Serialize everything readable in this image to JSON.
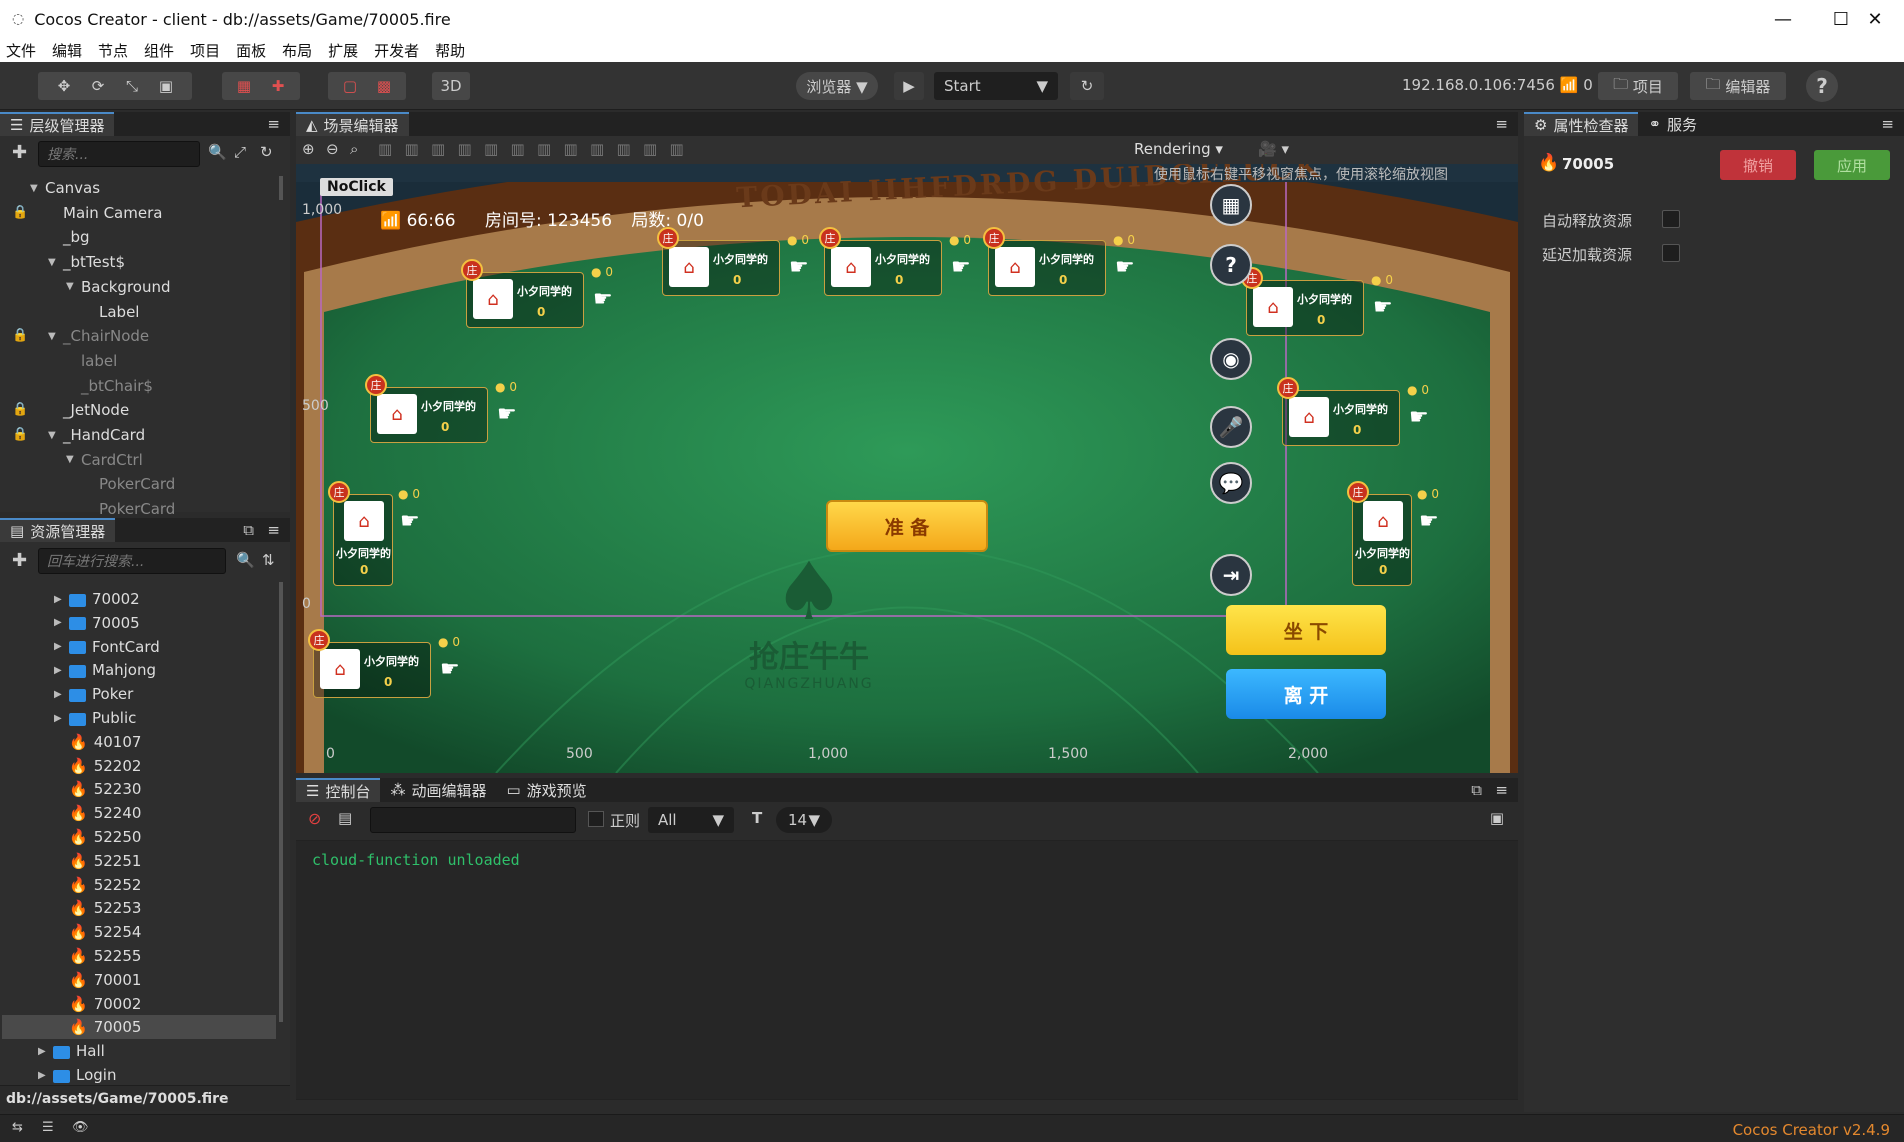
{
  "window": {
    "title": "Cocos Creator - client - db://assets/Game/70005.fire",
    "min": "—",
    "max": "☐",
    "close": "✕"
  },
  "menu": [
    "文件",
    "编辑",
    "节点",
    "组件",
    "项目",
    "面板",
    "布局",
    "扩展",
    "开发者",
    "帮助"
  ],
  "toolbar": {
    "browser_label": "浏览器 ▼",
    "play": "▶",
    "start_select": "Start",
    "three_d": "3D",
    "ip": "192.168.0.106:7456",
    "conn_count": "0",
    "project_btn": "项目",
    "editor_btn": "编辑器",
    "help": "?"
  },
  "hierarchy": {
    "tab": "层级管理器",
    "search_placeholder": "搜索...",
    "items": [
      {
        "label": "Canvas",
        "depth": 0,
        "open": true,
        "lock": false,
        "dim": false
      },
      {
        "label": "Main Camera",
        "depth": 1,
        "open": null,
        "lock": true,
        "dim": false
      },
      {
        "label": "_bg",
        "depth": 1,
        "open": null,
        "lock": false,
        "dim": false
      },
      {
        "label": "_btTest$",
        "depth": 1,
        "open": true,
        "lock": false,
        "dim": false
      },
      {
        "label": "Background",
        "depth": 2,
        "open": true,
        "lock": false,
        "dim": false
      },
      {
        "label": "Label",
        "depth": 3,
        "open": null,
        "lock": false,
        "dim": false
      },
      {
        "label": "_ChairNode",
        "depth": 1,
        "open": true,
        "lock": true,
        "dim": true
      },
      {
        "label": "label",
        "depth": 2,
        "open": null,
        "lock": false,
        "dim": true
      },
      {
        "label": "_btChair$",
        "depth": 2,
        "open": null,
        "lock": false,
        "dim": true
      },
      {
        "label": "_JetNode",
        "depth": 1,
        "open": null,
        "lock": true,
        "dim": false
      },
      {
        "label": "_HandCard",
        "depth": 1,
        "open": true,
        "lock": true,
        "dim": false
      },
      {
        "label": "CardCtrl",
        "depth": 2,
        "open": true,
        "lock": false,
        "dim": true
      },
      {
        "label": "PokerCard",
        "depth": 3,
        "open": null,
        "lock": false,
        "dim": true
      },
      {
        "label": "PokerCard",
        "depth": 3,
        "open": null,
        "lock": false,
        "dim": true
      }
    ]
  },
  "assets": {
    "tab": "资源管理器",
    "search_placeholder": "回车进行搜索...",
    "items": [
      {
        "label": "70002",
        "kind": "folder",
        "depth": 1
      },
      {
        "label": "70005",
        "kind": "folder",
        "depth": 1
      },
      {
        "label": "FontCard",
        "kind": "folder",
        "depth": 1
      },
      {
        "label": "Mahjong",
        "kind": "folder",
        "depth": 1
      },
      {
        "label": "Poker",
        "kind": "folder",
        "depth": 1
      },
      {
        "label": "Public",
        "kind": "folder",
        "depth": 1
      },
      {
        "label": "40107",
        "kind": "fire",
        "depth": 1
      },
      {
        "label": "52202",
        "kind": "fire",
        "depth": 1
      },
      {
        "label": "52230",
        "kind": "fire",
        "depth": 1
      },
      {
        "label": "52240",
        "kind": "fire",
        "depth": 1
      },
      {
        "label": "52250",
        "kind": "fire",
        "depth": 1
      },
      {
        "label": "52251",
        "kind": "fire",
        "depth": 1
      },
      {
        "label": "52252",
        "kind": "fire",
        "depth": 1
      },
      {
        "label": "52253",
        "kind": "fire",
        "depth": 1
      },
      {
        "label": "52254",
        "kind": "fire",
        "depth": 1
      },
      {
        "label": "52255",
        "kind": "fire",
        "depth": 1
      },
      {
        "label": "70001",
        "kind": "fire",
        "depth": 1
      },
      {
        "label": "70002",
        "kind": "fire",
        "depth": 1
      },
      {
        "label": "70005",
        "kind": "fire",
        "depth": 1,
        "selected": true
      },
      {
        "label": "Hall",
        "kind": "folder",
        "depth": 0
      },
      {
        "label": "Login",
        "kind": "folder",
        "depth": 0
      }
    ],
    "path": "db://assets/Game/70005.fire"
  },
  "scene": {
    "tab": "场景编辑器",
    "rendering": "Rendering",
    "hint": "使用鼠标右键平移视窗焦点，使用滚轮缩放视图",
    "noclick": "NoClick",
    "y_ticks": [
      "1,000",
      "500",
      "0"
    ],
    "x_ticks": [
      "0",
      "500",
      "1,000",
      "1,500",
      "2,000"
    ],
    "arc_text": "TODAI IIHFDRDG DUIDOFLUCK",
    "signal_value": "66:66",
    "room": "房间号: 123456",
    "round": "局数: 0/0",
    "ready_btn": "准 备",
    "sit_btn": "坐 下",
    "leave_btn": "离 开",
    "logo_cn": "抢庄牛牛",
    "logo_en": "QIANGZHUANG",
    "player_name": "小夕同学的",
    "zero": "0",
    "banker": "庄"
  },
  "inspector": {
    "tab": "属性检查器",
    "tab2": "服务",
    "asset_name": "70005",
    "revert": "撤销",
    "apply": "应用",
    "auto_release": "自动释放资源",
    "delay_load": "延迟加载资源"
  },
  "console": {
    "tab": "控制台",
    "tab2": "动画编辑器",
    "tab3": "游戏预览",
    "regex": "正则",
    "level": "All",
    "font_size": "14",
    "log": "cloud-function unloaded"
  },
  "status": {
    "version": "Cocos Creator v2.4.9"
  },
  "colors": {
    "accent": "#4a8ac8",
    "revert": "#c0333a",
    "apply": "#4a9a3a",
    "table": "#1f6a3e",
    "log": "#2fbf6a"
  }
}
